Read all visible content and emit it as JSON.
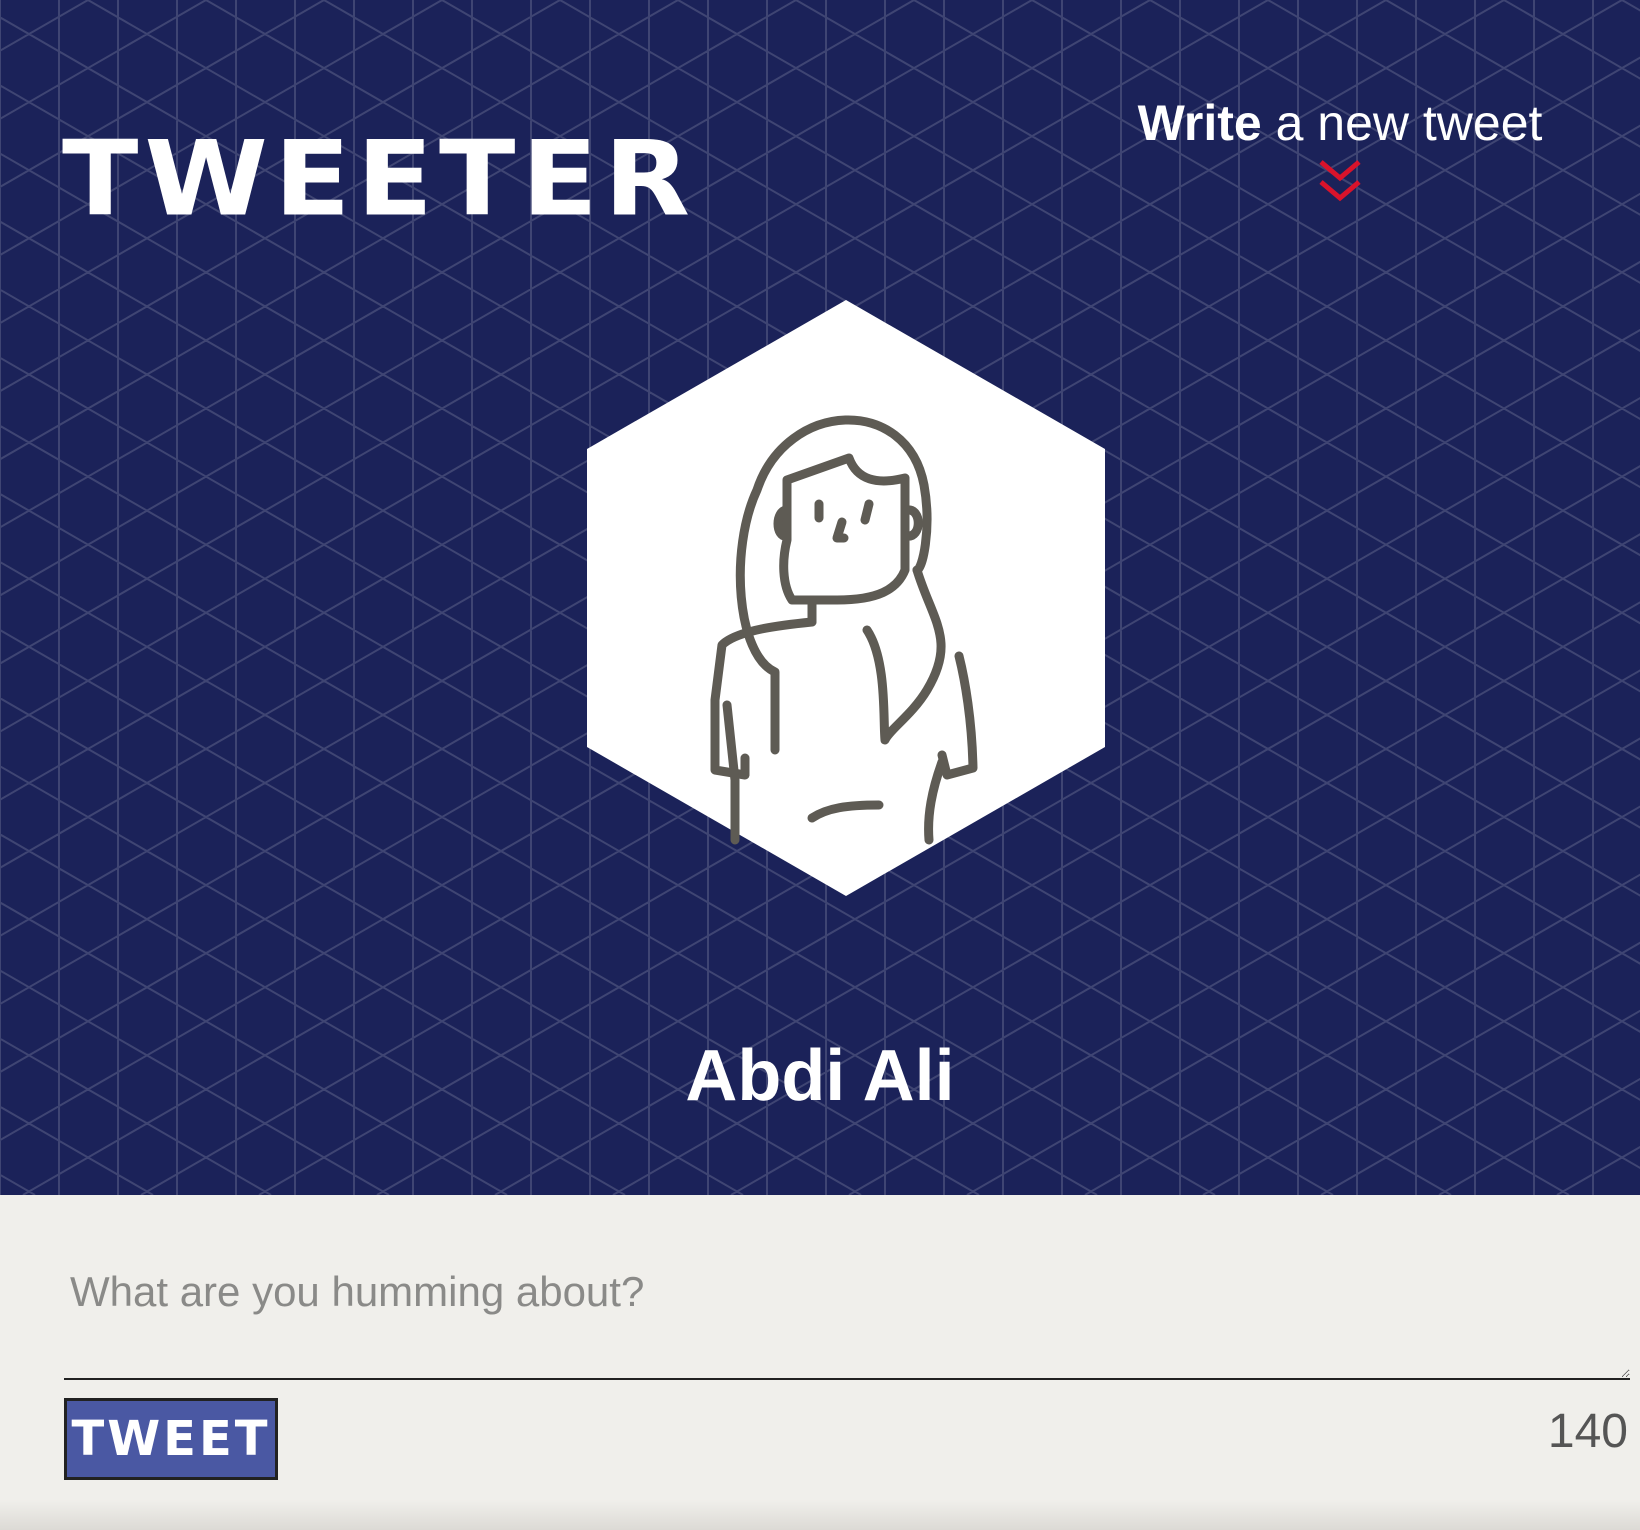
{
  "brand": {
    "logo_text": "TWEETER"
  },
  "compose_toggle": {
    "label_bold": "Write",
    "label_rest": " a new tweet",
    "icon": "double-chevron-down-icon",
    "icon_color": "#d9132b"
  },
  "profile": {
    "name": "Abdi Ali",
    "avatar_icon": "woman-avatar-icon"
  },
  "composer": {
    "placeholder": "What are you humming about?",
    "value": "",
    "button_label": "TWEET",
    "char_count": "140"
  },
  "colors": {
    "header_bg": "#1b2259",
    "page_bg": "#f0efeb",
    "button_bg": "#4a58a3",
    "accent": "#d9132b"
  }
}
